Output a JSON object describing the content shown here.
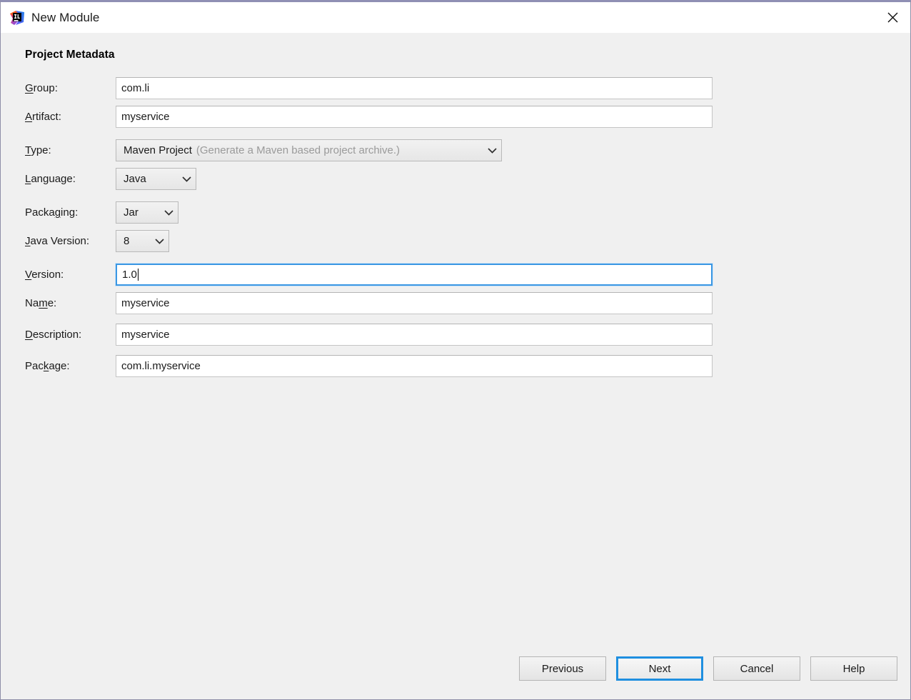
{
  "window": {
    "title": "New Module",
    "icon": "intellij-idea-icon",
    "close_label": "✕",
    "accent_color": "#8f8fb4",
    "body_background": "#f0f0f0"
  },
  "section": {
    "title": "Project Metadata"
  },
  "fields": {
    "group": {
      "label_pre": "",
      "label_mnemonic": "G",
      "label_post": "roup:",
      "value": "com.li",
      "type": "text"
    },
    "artifact": {
      "label_pre": "",
      "label_mnemonic": "A",
      "label_post": "rtifact:",
      "value": "myservice",
      "type": "text"
    },
    "type": {
      "label_pre": "",
      "label_mnemonic": "T",
      "label_post": "ype:",
      "value": "Maven Project",
      "hint": "(Generate a Maven based project archive.)",
      "type": "combo"
    },
    "language": {
      "label_pre": "",
      "label_mnemonic": "L",
      "label_post": "anguage:",
      "value": "Java",
      "type": "combo"
    },
    "packaging": {
      "label_pre": "Packa",
      "label_mnemonic": "g",
      "label_post": "ing:",
      "value": "Jar",
      "type": "combo"
    },
    "java_version": {
      "label_pre": "",
      "label_mnemonic": "J",
      "label_post": "ava Version:",
      "value": "8",
      "type": "combo"
    },
    "version": {
      "label_pre": "",
      "label_mnemonic": "V",
      "label_post": "ersion:",
      "value": "1.0",
      "type": "text",
      "focused": true,
      "focus_color": "#3b97e3"
    },
    "name": {
      "label_pre": "Na",
      "label_mnemonic": "m",
      "label_post": "e:",
      "value": "myservice",
      "type": "text"
    },
    "description": {
      "label_pre": "",
      "label_mnemonic": "D",
      "label_post": "escription:",
      "value": "myservice",
      "type": "text"
    },
    "package": {
      "label_pre": "Pac",
      "label_mnemonic": "k",
      "label_post": "age:",
      "value": "com.li.myservice",
      "type": "text"
    }
  },
  "footer": {
    "previous_label": "Previous",
    "next_label": "Next",
    "cancel_label": "Cancel",
    "help_label": "Help",
    "default_button": "Next",
    "default_border_color": "#1f8fe0"
  }
}
